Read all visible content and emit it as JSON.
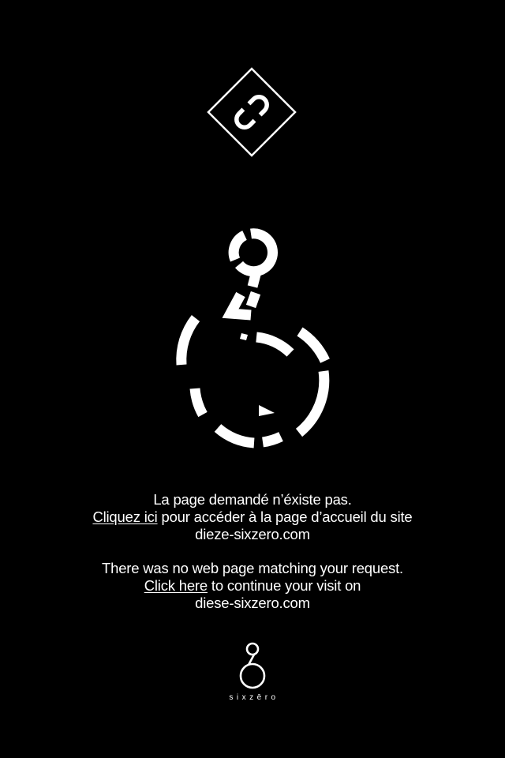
{
  "colors": {
    "background": "#000000",
    "foreground": "#ffffff"
  },
  "icons": {
    "badge": "broken-link-icon",
    "hero": "broken-sixzero-icon",
    "footer": "sixzero-logo-icon"
  },
  "message_fr": {
    "line1": "La page demandé n’éxiste pas.",
    "link_label": "Cliquez ici",
    "line2_rest": " pour accéder à la page d’accueil du site",
    "line3": "dieze-sixzero.com"
  },
  "message_en": {
    "line1": "There was no web page matching your request.",
    "link_label": "Click here",
    "line2_rest": " to continue your visit on",
    "line3": "diese-sixzero.com"
  },
  "footer": {
    "wordmark": "sixzēro"
  }
}
